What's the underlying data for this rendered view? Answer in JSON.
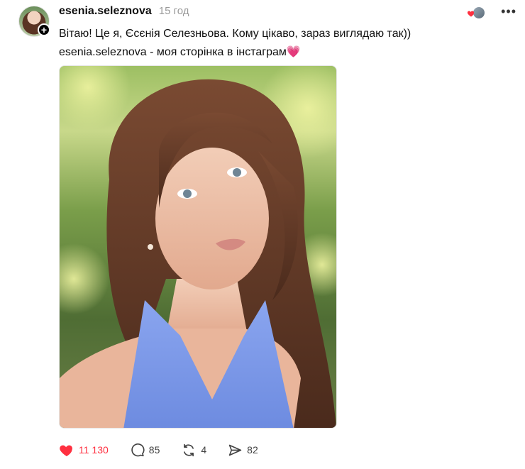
{
  "post": {
    "username": "esenia.seleznova",
    "time": "15 год",
    "text_line1": "Вітаю! Це я, Єсєнія Селезньова. Кому цікаво, зараз виглядаю так))",
    "text_line2": "esenia.seleznova - моя сторінка в інстаграм",
    "emoji": "💗",
    "follow_badge": "+",
    "more": "•••",
    "colors": {
      "like": "#ff3040",
      "text": "#101010",
      "muted": "#999999"
    }
  },
  "actions": {
    "likes": "11 130",
    "replies": "85",
    "reposts": "4",
    "shares": "82"
  },
  "icons": {
    "like": "heart-filled-icon",
    "reply": "comment-icon",
    "repost": "repost-icon",
    "share": "send-icon",
    "more": "more-icon"
  }
}
